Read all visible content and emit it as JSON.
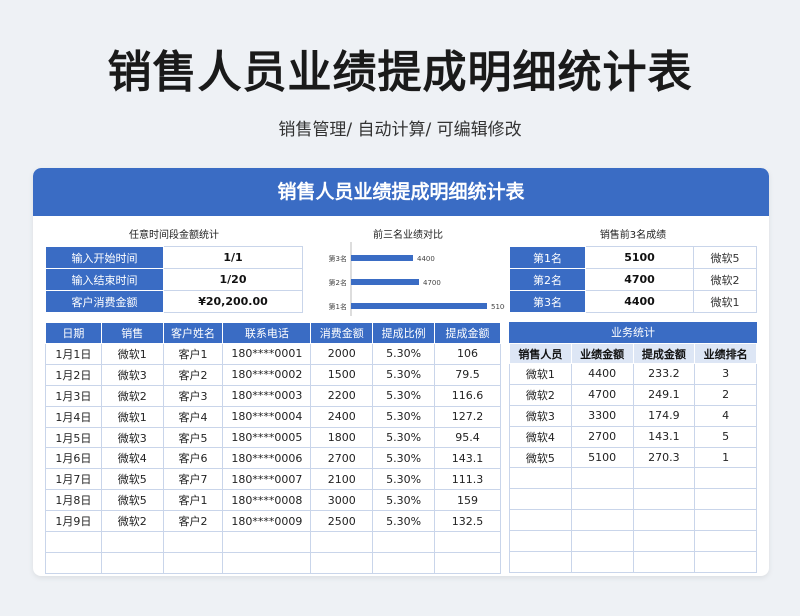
{
  "title": "销售人员业绩提成明细统计表",
  "subtitle": "销售管理/ 自动计算/ 可编辑修改",
  "card_title": "销售人员业绩提成明细统计表",
  "panels": {
    "range_title": "任意时间段金额统计",
    "compare_title": "前三名业绩对比",
    "top3_title": "销售前3名成绩",
    "stats_title": "业务统计"
  },
  "range": {
    "start_label": "输入开始时间",
    "start_value": "1/1",
    "end_label": "输入结束时间",
    "end_value": "1/20",
    "amount_label": "客户消费金额",
    "amount_value": "¥20,200.00"
  },
  "top3": [
    {
      "rank": "第1名",
      "amount": "5100",
      "name": "微软5"
    },
    {
      "rank": "第2名",
      "amount": "4700",
      "name": "微软2"
    },
    {
      "rank": "第3名",
      "amount": "4400",
      "name": "微软1"
    }
  ],
  "chart_data": {
    "type": "bar",
    "orientation": "horizontal",
    "categories": [
      "第3名",
      "第2名",
      "第1名"
    ],
    "values": [
      4400,
      4700,
      5100
    ],
    "title": "前三名业绩对比",
    "color": "#3a6cc4",
    "xlim": [
      0,
      5100
    ]
  },
  "main_table": {
    "headers": [
      "日期",
      "销售",
      "客户姓名",
      "联系电话",
      "消费金额",
      "提成比例",
      "提成金额"
    ],
    "rows": [
      [
        "1月1日",
        "微软1",
        "客户1",
        "180****0001",
        "2000",
        "5.30%",
        "106"
      ],
      [
        "1月2日",
        "微软3",
        "客户2",
        "180****0002",
        "1500",
        "5.30%",
        "79.5"
      ],
      [
        "1月3日",
        "微软2",
        "客户3",
        "180****0003",
        "2200",
        "5.30%",
        "116.6"
      ],
      [
        "1月4日",
        "微软1",
        "客户4",
        "180****0004",
        "2400",
        "5.30%",
        "127.2"
      ],
      [
        "1月5日",
        "微软3",
        "客户5",
        "180****0005",
        "1800",
        "5.30%",
        "95.4"
      ],
      [
        "1月6日",
        "微软4",
        "客户6",
        "180****0006",
        "2700",
        "5.30%",
        "143.1"
      ],
      [
        "1月7日",
        "微软5",
        "客户7",
        "180****0007",
        "2100",
        "5.30%",
        "111.3"
      ],
      [
        "1月8日",
        "微软5",
        "客户1",
        "180****0008",
        "3000",
        "5.30%",
        "159"
      ],
      [
        "1月9日",
        "微软2",
        "客户2",
        "180****0009",
        "2500",
        "5.30%",
        "132.5"
      ],
      [
        "",
        "",
        "",
        "",
        "",
        "",
        ""
      ],
      [
        "",
        "",
        "",
        "",
        "",
        "",
        ""
      ]
    ]
  },
  "stats_table": {
    "headers": [
      "销售人员",
      "业绩金额",
      "提成金额",
      "业绩排名"
    ],
    "rows": [
      [
        "微软1",
        "4400",
        "233.2",
        "3"
      ],
      [
        "微软2",
        "4700",
        "249.1",
        "2"
      ],
      [
        "微软3",
        "3300",
        "174.9",
        "4"
      ],
      [
        "微软4",
        "2700",
        "143.1",
        "5"
      ],
      [
        "微软5",
        "5100",
        "270.3",
        "1"
      ],
      [
        "",
        "",
        "",
        ""
      ],
      [
        "",
        "",
        "",
        ""
      ],
      [
        "",
        "",
        "",
        ""
      ],
      [
        "",
        "",
        "",
        ""
      ],
      [
        "",
        "",
        "",
        ""
      ]
    ]
  }
}
